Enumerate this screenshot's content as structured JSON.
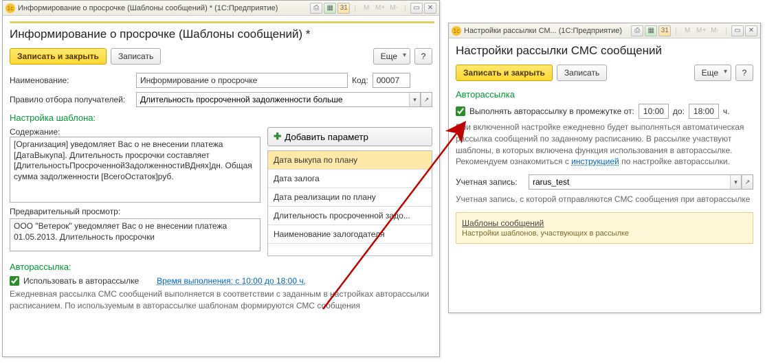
{
  "left": {
    "titlebar": "Информирование о просрочке (Шаблоны сообщений) * (1С:Предприятие)",
    "header": "Информирование о просрочке (Шаблоны сообщений) *",
    "btn_save_close": "Записать и закрыть",
    "btn_save": "Записать",
    "btn_more": "Еще",
    "btn_help": "?",
    "name_lbl": "Наименование:",
    "name_val": "Информирование о просрочке",
    "code_lbl": "Код:",
    "code_val": "00007",
    "rule_lbl": "Правило отбора получателей:",
    "rule_val": "Длительность просроченной задолженности больше",
    "template_section": "Настройка шаблона:",
    "content_lbl": "Содержание:",
    "content_val": "[Организация] уведомляет Вас о не внесении платежа [ДатаВыкупа]. Длительность просрочки составляет [ДлительностьПросроченнойЗадолженностиВДнях]дн. Общая сумма задолженности [ВсегоОстаток]руб.",
    "preview_lbl": "Предварительный просмотр:",
    "preview_val": "ООО \"Ветерок\" уведомляет Вас о не внесении платежа 01.05.2013. Длительность просрочки",
    "add_param_btn": "Добавить параметр",
    "params": [
      "Дата выкупа по плану",
      "Дата залога",
      "Дата реализации по плану",
      "Длительность просроченной задо...",
      "Наименование залогодателя"
    ],
    "auto_section": "Авторассылка:",
    "auto_checkbox": "Использовать в авторассылке",
    "auto_time_link": "Время выполнения: с 10:00 до 18:00 ч.",
    "auto_desc": "Ежедневная рассылка СМС сообщений выполняется в соответствии с заданным в настройках авторассылки расписанием. По используемым в авторассылке шаблонам формируются СМС сообщения"
  },
  "right": {
    "titlebar": "Настройки рассылки СМ... (1С:Предприятие)",
    "header": "Настройки рассылки СМС сообщений",
    "btn_save_close": "Записать и закрыть",
    "btn_save": "Записать",
    "btn_more": "Еще",
    "btn_help": "?",
    "auto_section": "Авторассылка",
    "auto_checkbox": "Выполнять авторассылку в промежутке от:",
    "time_from": "10:00",
    "time_to_lbl": "до:",
    "time_to": "18:00",
    "time_unit": "ч.",
    "auto_desc1": "При включенной настройке ежедневно будет выполняться автоматическая рассылка сообщений по заданному расписанию. В рассылке участвуют шаблоны, в которых включена функция использования в авторассылке. Рекомендуем ознакомиться с ",
    "auto_desc_link": "инструкцией",
    "auto_desc2": " по настройке авторассылки.",
    "acct_lbl": "Учетная запись:",
    "acct_val": "rarus_test",
    "acct_desc": "Учетная запись, с которой отправляются СМС сообщения при авторассылке",
    "note_link": "Шаблоны сообщений",
    "note_sub": "Настройки шаблонов, участвующих в рассылке"
  },
  "tb_icons": {
    "m": "M",
    "mp": "M+",
    "mm": "M-"
  }
}
